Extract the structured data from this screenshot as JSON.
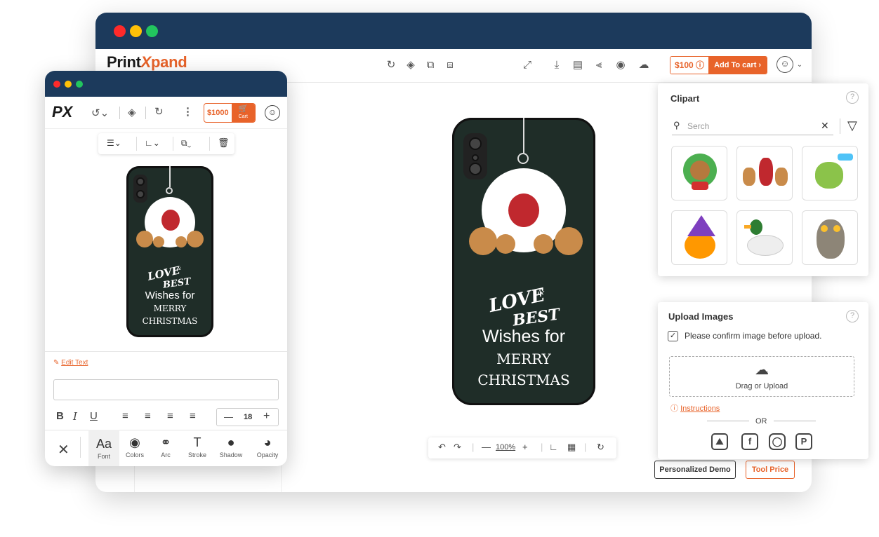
{
  "desktop": {
    "brand_a": "Print",
    "brand_x": "X",
    "brand_b": "pand",
    "price": "$100",
    "price_info": "ⓘ",
    "cart_label": "Add To cart",
    "cart_chevron": "›",
    "zoom": "100%",
    "personalized_demo": "Personalized Demo",
    "tool_price": "Tool Price"
  },
  "design": {
    "line1": "LOVE",
    "amp": "&",
    "line2": "BEST",
    "line3": "Wishes for",
    "line4": "MERRY",
    "line5": "CHRISTMAS"
  },
  "clipart": {
    "title": "Clipart",
    "help": "?",
    "search_placeholder": "Serch",
    "items": [
      "wreath-bear",
      "reindeer-group",
      "dinosaur",
      "pumpkin-witch",
      "duck",
      "owl"
    ]
  },
  "upload": {
    "title": "Upload Images",
    "help": "?",
    "confirm_label": "Please confirm image before upload.",
    "drag_label": "Drag or Upload",
    "instructions": "Instructions",
    "or": "OR"
  },
  "mobile": {
    "logo": "PX",
    "price": "$1000",
    "cart_label": "Cart",
    "edit_text": "Edit Text",
    "font_size": "18",
    "tools": [
      "Font",
      "Colors",
      "Arc",
      "Stroke",
      "Shadow",
      "Opacity"
    ],
    "font_tool_icon": "Aa"
  },
  "colors": {
    "navy": "#1c3a5c",
    "accent": "#e8632a",
    "case": "#1f2d28"
  }
}
